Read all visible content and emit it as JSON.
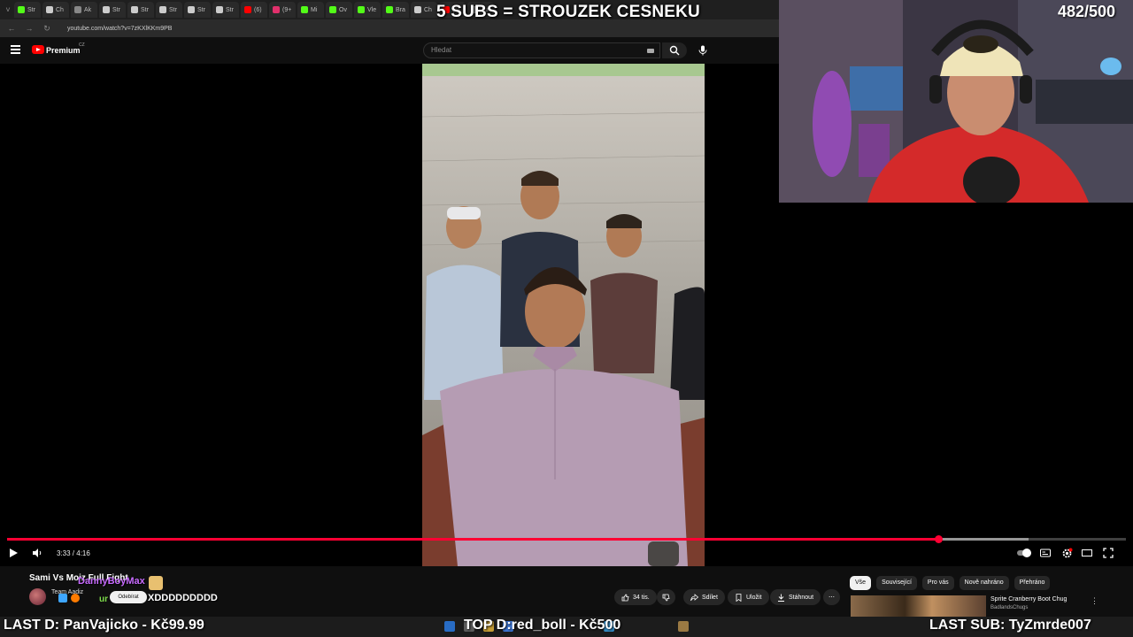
{
  "browser": {
    "tabs": [
      {
        "label": "Str",
        "color": "#53fc18"
      },
      {
        "label": "Ch",
        "color": "#cccccc"
      },
      {
        "label": "Ak",
        "color": "#888888"
      },
      {
        "label": "Str",
        "color": "#cccccc"
      },
      {
        "label": "Str",
        "color": "#cccccc"
      },
      {
        "label": "Str",
        "color": "#cccccc"
      },
      {
        "label": "Str",
        "color": "#cccccc"
      },
      {
        "label": "Str",
        "color": "#cccccc"
      },
      {
        "label": "(6)",
        "color": "#ff0000"
      },
      {
        "label": "(9+",
        "color": "#e1306c"
      },
      {
        "label": "Mi",
        "color": "#53fc18"
      },
      {
        "label": "Ov",
        "color": "#53fc18"
      },
      {
        "label": "Vle",
        "color": "#53fc18"
      },
      {
        "label": "Bra",
        "color": "#53fc18"
      },
      {
        "label": "Ch",
        "color": "#cccccc"
      },
      {
        "label": "(6)",
        "color": "#ff0000"
      },
      {
        "label": "Tu",
        "color": "#cccccc"
      }
    ],
    "url": "youtube.com/watch?v=7zKXlKKm9PB"
  },
  "youtube": {
    "brand": "Premium",
    "region": "CZ",
    "search_placeholder": "Hledat"
  },
  "player": {
    "current_time": "3:33",
    "duration": "4:16",
    "time_display": "3:33 / 4:16",
    "progress_fraction": 0.832,
    "buffered_fraction": 0.913,
    "accent_color": "#ff0033"
  },
  "video": {
    "title": "Sami Vs Moiz Full Fight",
    "channel": "Team Aadiz",
    "subscribe_label": "Odebírat",
    "actions": {
      "like": "34 tis.",
      "share": "Sdílet",
      "save": "Uložit",
      "download": "Stáhnout"
    }
  },
  "related": {
    "chips": [
      "Vše",
      "Související",
      "Pro vás",
      "Nově nahráno",
      "Přehráno"
    ],
    "active_chip": "Vše",
    "first_title": "Sprite Cranberry Boot Chug",
    "first_channel": "BadlandsChugs"
  },
  "overlay": {
    "sub_goal": "5 SUBS = STROUZEK CESNEKU",
    "counter": "482/500",
    "chat_user": "DannyBoyMax",
    "chat_prefix": "ur",
    "chat_text": "XDDDDDDDDD",
    "last_donation": "LAST D: PanVajicko - Kč99.99",
    "top_donation": "TOP D:red_boll - Kč500",
    "last_sub": "LAST SUB: TyZmrde007"
  }
}
